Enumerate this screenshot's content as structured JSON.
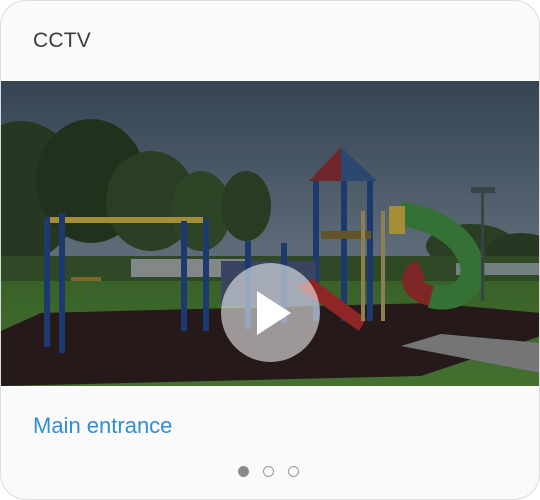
{
  "widget": {
    "title": "CCTV",
    "camera": {
      "name": "Main entrance"
    },
    "pagination": {
      "pages": 3,
      "active_index": 0
    }
  },
  "icons": {
    "play": "play-icon"
  },
  "colors": {
    "link": "#2f8fd3",
    "title": "#3c3c3c",
    "dot_active": "#8a8a8a",
    "dot_inactive": "#9a9a9a"
  }
}
